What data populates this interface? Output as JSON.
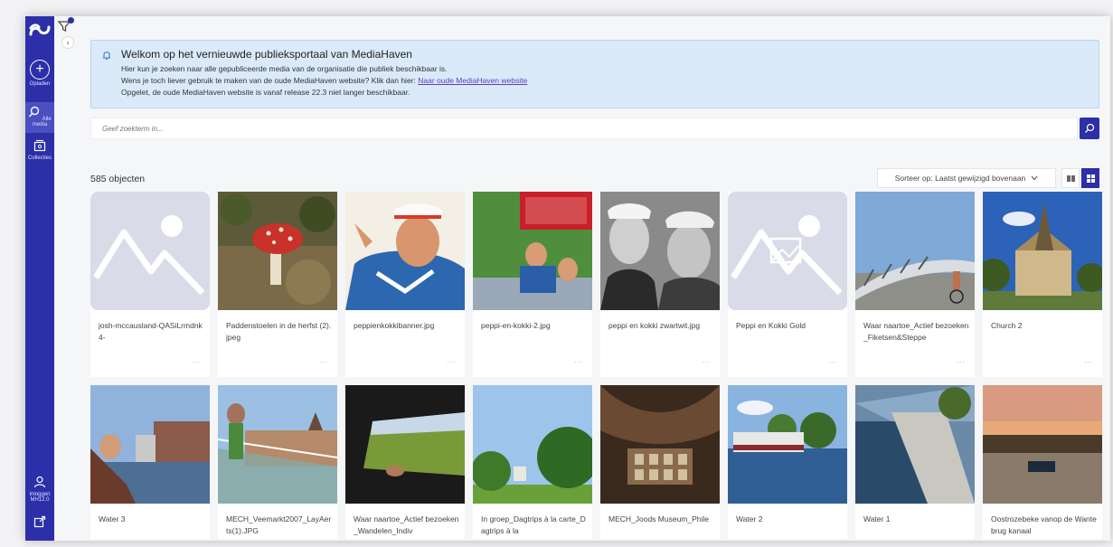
{
  "sidebar": {
    "upload_label": "Opladen",
    "media_label": "Alle media",
    "collections_label": "Collecties",
    "login_label": "Inloggen",
    "version_label": "MH12.0"
  },
  "banner": {
    "title": "Welkom op het vernieuwde publieksportaal van MediaHaven",
    "line1": "Hier kun je zoeken naar alle gepubliceerde media van de organisatie die publiek beschikbaar is.",
    "line2_prefix": "Wens je toch liever gebruik te maken van de oude MediaHaven website? Klik dan hier: ",
    "line2_link": "Naar oude MediaHaven website",
    "line3": "Opgelet, de oude MediaHaven website is vanaf release 22.3 niet langer beschikbaar."
  },
  "search": {
    "placeholder": "Geef zoekterm in..."
  },
  "results": {
    "count_label": "585 objecten",
    "sort_label": "Sorteer op: Laatst gewijzigd bovenaan"
  },
  "cards_row1": [
    {
      "title": "josh-mccausland-QASiLrmdnk4-",
      "more": "...",
      "thumb": "placeholder"
    },
    {
      "title": "Paddenstoelen in de herfst (2).jpeg",
      "more": "...",
      "thumb": "mushroom"
    },
    {
      "title": "peppienkokkibanner.jpg",
      "more": "...",
      "thumb": "sailor"
    },
    {
      "title": "peppi-en-kokki-2.jpg",
      "more": "...",
      "thumb": "poster"
    },
    {
      "title": "peppi en kokki zwartwit.jpg",
      "more": "...",
      "thumb": "bw-duo"
    },
    {
      "title": "Peppi en Kokki Gold",
      "more": "...",
      "thumb": "placeholder-image"
    },
    {
      "title": "Waar naartoe_Actief bezoeken_Fiketsen&Steppe",
      "more": "...",
      "thumb": "bridge"
    },
    {
      "title": "Church 2",
      "more": "...",
      "thumb": "church"
    }
  ],
  "cards_row2": [
    {
      "title": "Water 3",
      "thumb": "boat-selfie"
    },
    {
      "title": "MECH_Veemarkt2007_LayAerts(1).JPG",
      "thumb": "market"
    },
    {
      "title": "Waar naartoe_Actief bezoeken_Wandelen_Indiv",
      "thumb": "window"
    },
    {
      "title": "In groep_Dagtrips à la carte_Dagtrips à la",
      "thumb": "park"
    },
    {
      "title": "MECH_Joods Museum_Phile",
      "thumb": "museum"
    },
    {
      "title": "Water 2",
      "thumb": "river-boat"
    },
    {
      "title": "Water 1",
      "thumb": "canal"
    },
    {
      "title": "Oostrozebeke vanop de Wantebrug kanaal",
      "thumb": "sunset"
    }
  ],
  "colors": {
    "accent": "#2b2fa8",
    "banner_bg": "#dbeaf8"
  }
}
